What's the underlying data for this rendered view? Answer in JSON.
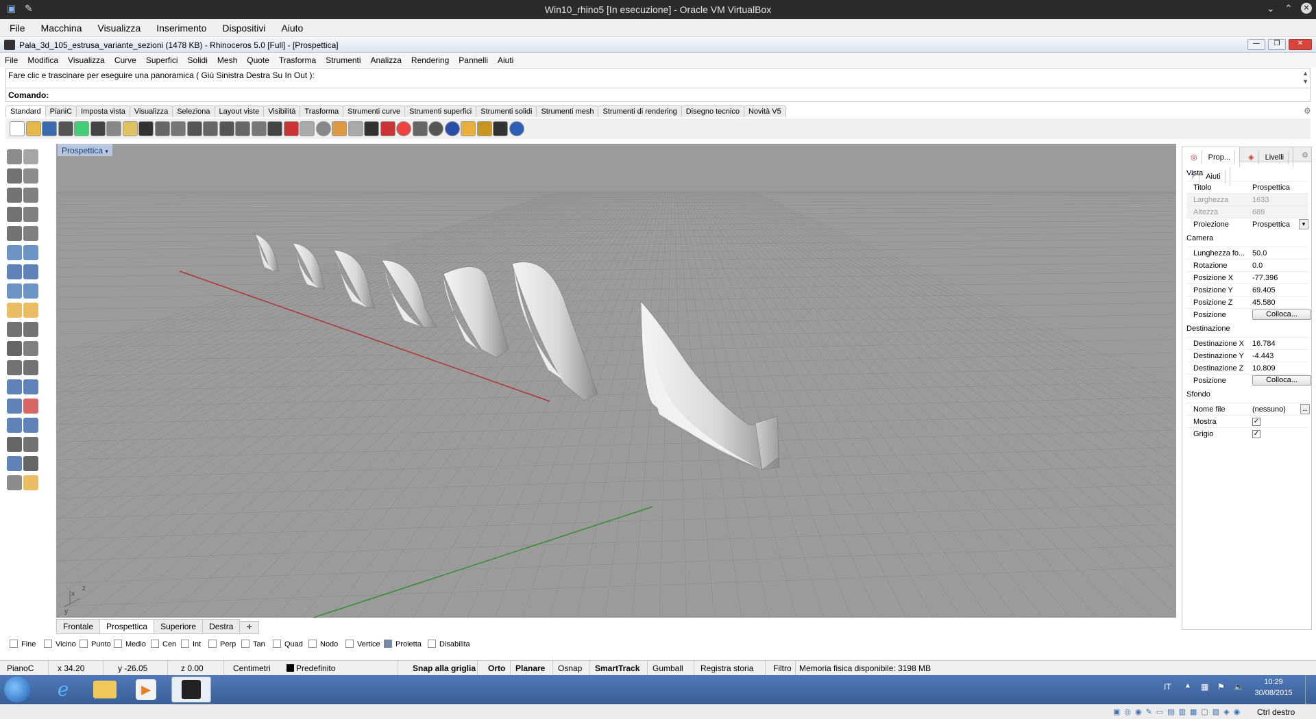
{
  "vbox": {
    "title": "Win10_rhino5 [In esecuzione] - Oracle VM VirtualBox",
    "menu": [
      "File",
      "Macchina",
      "Visualizza",
      "Inserimento",
      "Dispositivi",
      "Aiuto"
    ],
    "host_key": "Ctrl destro"
  },
  "rhino": {
    "title": "Pala_3d_105_estrusa_variante_sezioni (1478 KB) - Rhinoceros 5.0 [Full] - [Prospettica]",
    "menu": [
      "File",
      "Modifica",
      "Visualizza",
      "Curve",
      "Superfici",
      "Solidi",
      "Mesh",
      "Quote",
      "Trasforma",
      "Strumenti",
      "Analizza",
      "Rendering",
      "Pannelli",
      "Aiuti"
    ],
    "command_history": "Fare clic e trascinare per eseguire una panoramica ( Giù  Sinistra  Destra  Su  In  Out ):",
    "command_prompt": "Comando:",
    "toolbar_tabs": [
      "Standard",
      "PianiC",
      "Imposta vista",
      "Visualizza",
      "Seleziona",
      "Layout viste",
      "Visibilità",
      "Trasforma",
      "Strumenti curve",
      "Strumenti superfici",
      "Strumenti solidi",
      "Strumenti mesh",
      "Strumenti di rendering",
      "Disegno tecnico",
      "Novità V5"
    ],
    "toolbar_icons": [
      "new-icon",
      "open-icon",
      "save-icon",
      "print-icon",
      "export-icon",
      "cut-icon",
      "copy-icon",
      "paste-icon",
      "undo-icon",
      "pan-icon",
      "move-view-icon",
      "zoom-icon",
      "zoom-window-icon",
      "zoom-extents-icon",
      "zoom-selected-icon",
      "rotate-view-icon",
      "four-views-icon",
      "car-icon",
      "render-icon",
      "circle-icon",
      "snap-icon",
      "light-icon",
      "lock-icon",
      "material-icon",
      "color-wheel-icon",
      "shade-icon",
      "rendered-sphere-icon",
      "blue-sphere-icon",
      "paint-icon",
      "settings-icon",
      "grid-icon",
      "help-icon"
    ],
    "viewport": {
      "label": "Prospettica",
      "tabs": [
        "Frontale",
        "Prospettica",
        "Superiore",
        "Destra"
      ],
      "active_tab": "Prospettica",
      "axis_labels": {
        "x": "x",
        "y": "y",
        "z": "z"
      },
      "colors": {
        "background": "#9b9b9b",
        "grid": "#8f8f8f",
        "x_axis": "#b03434",
        "y_axis": "#2f8f2f"
      }
    },
    "panel": {
      "tabs": [
        "Prop...",
        "Livelli",
        "Aiuti"
      ],
      "sections": {
        "vista": "Vista",
        "camera": "Camera",
        "destinazione": "Destinazione",
        "sfondo": "Sfondo"
      },
      "titolo": {
        "k": "Titolo",
        "v": "Prospettica"
      },
      "larghezza": {
        "k": "Larghezza",
        "v": "1633"
      },
      "altezza": {
        "k": "Altezza",
        "v": "689"
      },
      "proiezione": {
        "k": "Proiezione",
        "v": "Prospettica"
      },
      "lunghezza": {
        "k": "Lunghezza fo...",
        "v": "50.0"
      },
      "rotazione": {
        "k": "Rotazione",
        "v": "0.0"
      },
      "pos_x": {
        "k": "Posizione X",
        "v": "-77.396"
      },
      "pos_y": {
        "k": "Posizione Y",
        "v": "69.405"
      },
      "pos_z": {
        "k": "Posizione Z",
        "v": "45.580"
      },
      "posizione1": {
        "k": "Posizione",
        "v": "Colloca..."
      },
      "dest_x": {
        "k": "Destinazione X",
        "v": "16.784"
      },
      "dest_y": {
        "k": "Destinazione Y",
        "v": "-4.443"
      },
      "dest_z": {
        "k": "Destinazione Z",
        "v": "10.809"
      },
      "posizione2": {
        "k": "Posizione",
        "v": "Colloca..."
      },
      "nome_file": {
        "k": "Nome file",
        "v": "(nessuno)",
        "btn": "..."
      },
      "mostra": {
        "k": "Mostra",
        "checked": "✓"
      },
      "grigio": {
        "k": "Grigio",
        "checked": "✓"
      }
    },
    "osnap": [
      {
        "label": "Fine",
        "on": false
      },
      {
        "label": "Vicino",
        "on": false
      },
      {
        "label": "Punto",
        "on": false
      },
      {
        "label": "Medio",
        "on": false
      },
      {
        "label": "Cen",
        "on": false
      },
      {
        "label": "Int",
        "on": false
      },
      {
        "label": "Perp",
        "on": false
      },
      {
        "label": "Tan",
        "on": false
      },
      {
        "label": "Quad",
        "on": false
      },
      {
        "label": "Nodo",
        "on": false
      },
      {
        "label": "Vertice",
        "on": false
      },
      {
        "label": "Proietta",
        "on": true
      },
      {
        "label": "Disabilita",
        "on": false
      }
    ],
    "status": {
      "plane": "PianoC",
      "x": "x 34.20",
      "y": "y -26.05",
      "z": "z 0.00",
      "units": "Centimetri",
      "layer": "Predefinito",
      "snap": "Snap alla griglia",
      "orto": "Orto",
      "planare": "Planare",
      "osnap": "Osnap",
      "smarttrack": "SmartTrack",
      "gumball": "Gumball",
      "storia": "Registra storia",
      "filtro": "Filtro",
      "memoria": "Memoria fisica disponibile: 3198 MB"
    }
  },
  "taskbar": {
    "lang": "IT",
    "time": "10:29",
    "date": "30/08/2015"
  }
}
